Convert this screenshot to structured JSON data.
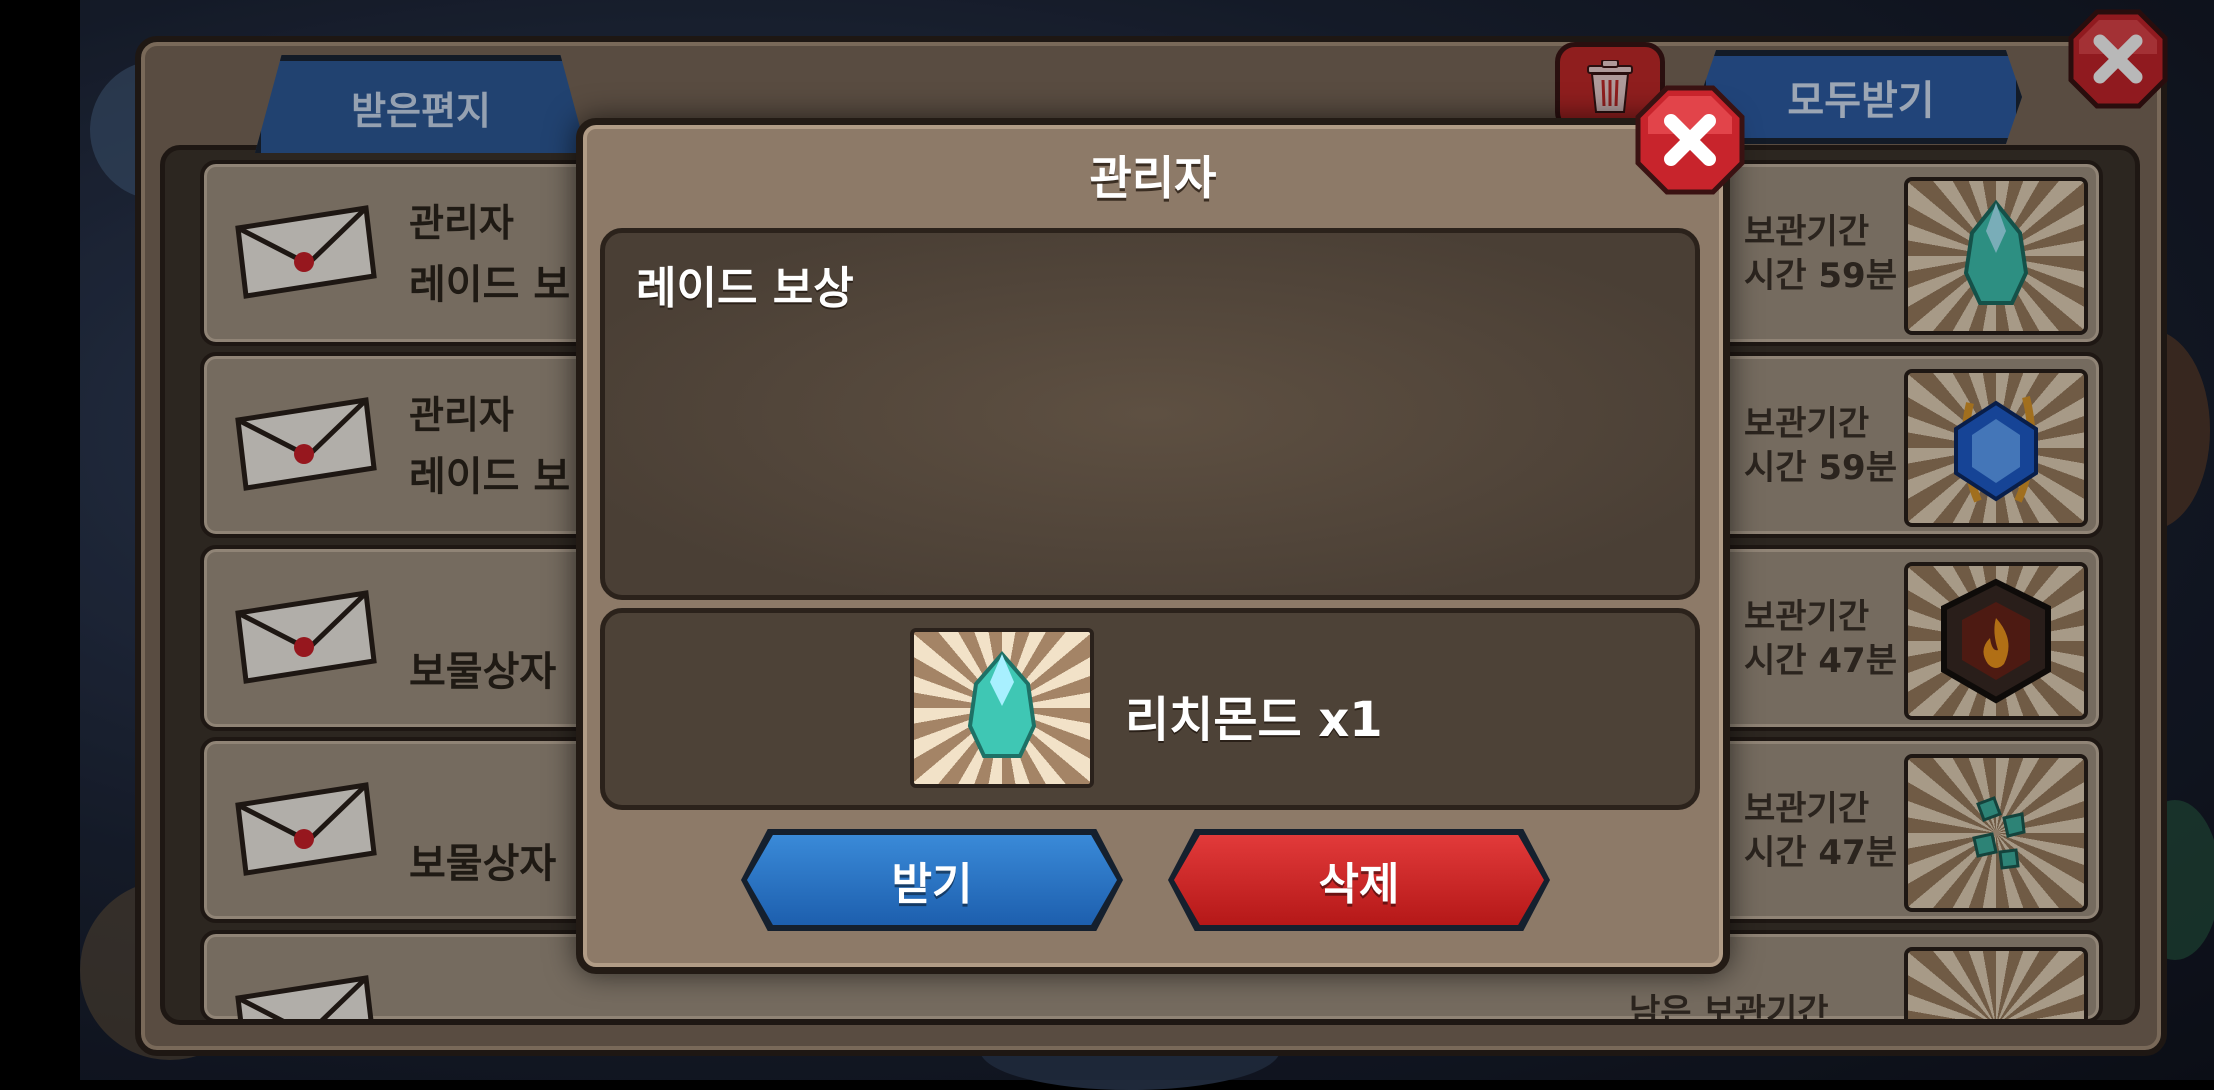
{
  "mailbox": {
    "tab_label": "받은편지",
    "receive_all_label": "모두받기",
    "rows": [
      {
        "sender": "관리자",
        "subject": "레이드 보",
        "expire_line1": "보관기간",
        "expire_line2": "시간 59분",
        "item_icon": "richmond-crystal-icon"
      },
      {
        "sender": "관리자",
        "subject": "레이드 보",
        "expire_line1": "보관기간",
        "expire_line2": "시간 59분",
        "item_icon": "blue-gem-icon"
      },
      {
        "sender": "",
        "subject": "보물상자",
        "expire_line1": "보관기간",
        "expire_line2": "시간 47분",
        "item_icon": "fire-emblem-icon"
      },
      {
        "sender": "",
        "subject": "보물상자",
        "expire_line1": "보관기간",
        "expire_line2": "시간 47분",
        "item_icon": "green-shards-icon"
      },
      {
        "sender": "",
        "subject": "",
        "expire_line1": "남은 보관기간",
        "expire_line2": "",
        "item_icon": "item-icon"
      }
    ]
  },
  "modal": {
    "title": "관리자",
    "message": "레이드 보상",
    "reward_label": "리치몬드 x1",
    "reward_icon": "richmond-crystal-icon",
    "receive_label": "받기",
    "delete_label": "삭제"
  },
  "colors": {
    "receive": "#1d5fae",
    "delete": "#b51818",
    "close": "#c8242c"
  }
}
